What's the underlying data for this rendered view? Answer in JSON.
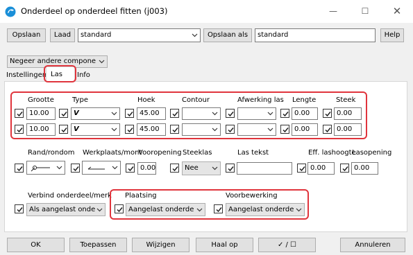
{
  "window": {
    "title": "Onderdeel op onderdeel fitten (j003)",
    "minimize_icon": "minimize-icon",
    "maximize_icon": "maximize-icon",
    "close_icon": "close-icon"
  },
  "toolbar": {
    "save_label": "Opslaan",
    "load_label": "Laad",
    "preset_value": "standard",
    "save_as_label": "Opslaan als",
    "save_as_value": "standard",
    "help_label": "Help"
  },
  "filter": {
    "value": "Negeer andere compone"
  },
  "tabs": [
    {
      "label": "Instellingen"
    },
    {
      "label": "Las"
    },
    {
      "label": "Info"
    }
  ],
  "weld_headers": {
    "size": "Grootte",
    "type": "Type",
    "angle": "Hoek",
    "contour": "Contour",
    "finish": "Afwerking las",
    "length": "Lengte",
    "pitch": "Steek"
  },
  "weld_rows": [
    {
      "size": "10.00",
      "type_symbol": "V",
      "angle": "45.00",
      "contour": "",
      "finish": "",
      "length": "0.00",
      "pitch": "0.00"
    },
    {
      "size": "10.00",
      "type_symbol": "V",
      "angle": "45.00",
      "contour": "",
      "finish": "",
      "length": "0.00",
      "pitch": "0.00"
    }
  ],
  "mid": {
    "around_label": "Rand/rondom",
    "workshop_label": "Werkplaats/mont",
    "pre_opening_label": "Vooropening",
    "pre_opening_value": "0.00",
    "stitch_label": "Steeklas",
    "stitch_value": "Nee",
    "text_label": "Las tekst",
    "text_value": "",
    "eff_throat_label": "Eff. lashoogte",
    "eff_throat_value": "0.00",
    "weld_opening_label": "Lasopening",
    "weld_opening_value": "0.00"
  },
  "bottom": {
    "connect_label": "Verbind onderdeel/merk",
    "connect_value": "Als aangelast onde",
    "placement_label": "Plaatsing",
    "placement_value": "Aangelast onderde",
    "prep_label": "Voorbewerking",
    "prep_value": "Aangelast onderde"
  },
  "footer": {
    "ok": "OK",
    "apply": "Toepassen",
    "modify": "Wijzigen",
    "get": "Haal op",
    "toggle": "✓ / ☐",
    "cancel": "Annuleren"
  }
}
